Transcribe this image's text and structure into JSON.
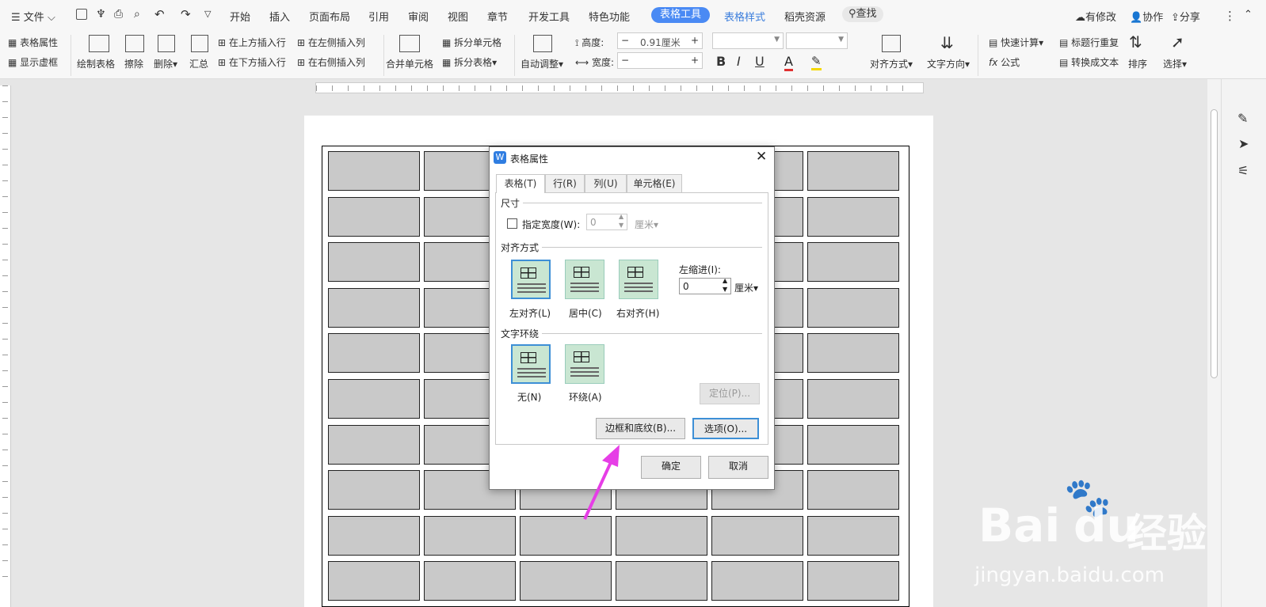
{
  "menubar": {
    "file": "文件",
    "tabs": [
      "开始",
      "插入",
      "页面布局",
      "引用",
      "审阅",
      "视图",
      "章节",
      "开发工具",
      "特色功能"
    ],
    "active_tab": "表格工具",
    "tabs_right": [
      "表格样式",
      "稻壳资源"
    ],
    "search": "查找",
    "modified": "有修改",
    "collab": "协作",
    "share": "分享"
  },
  "ribbon": {
    "table_props": "表格属性",
    "show_grid": "显示虚框",
    "draw_table": "绘制表格",
    "erase": "擦除",
    "delete": "删除",
    "summary": "汇总",
    "insert_above": "在上方插入行",
    "insert_below": "在下方插入行",
    "insert_left": "在左侧插入列",
    "insert_right": "在右侧插入列",
    "merge": "合并单元格",
    "split_cell": "拆分单元格",
    "split_table": "拆分表格",
    "autofit": "自动调整",
    "height_label": "高度:",
    "height_value": "0.91厘米",
    "width_label": "宽度:",
    "width_value": "",
    "align": "对齐方式",
    "text_dir": "文字方向",
    "quick_calc": "快速计算",
    "formula": "公式",
    "repeat_header": "标题行重复",
    "to_text": "转换成文本",
    "sort": "排序",
    "select": "选择"
  },
  "dialog": {
    "title": "表格属性",
    "tabs": [
      "表格(T)",
      "行(R)",
      "列(U)",
      "单元格(E)"
    ],
    "size_section": "尺寸",
    "specify_width": "指定宽度(W):",
    "width_value": "0",
    "width_unit": "厘米",
    "align_section": "对齐方式",
    "align_left": "左对齐(L)",
    "align_center": "居中(C)",
    "align_right": "右对齐(H)",
    "left_indent": "左缩进(I):",
    "indent_value": "0",
    "indent_unit": "厘米",
    "wrap_section": "文字环绕",
    "wrap_none": "无(N)",
    "wrap_around": "环绕(A)",
    "position_btn": "定位(P)...",
    "borders_btn": "边框和底纹(B)...",
    "options_btn": "选项(O)...",
    "ok_btn": "确定",
    "cancel_btn": "取消"
  },
  "watermark": {
    "brand": "Bai",
    "brand2": "经验",
    "url": "jingyan.baidu.com"
  },
  "colors": {
    "accent": "#4a8af4",
    "arrow": "#e63ee6",
    "green": "#c9e6d2"
  }
}
